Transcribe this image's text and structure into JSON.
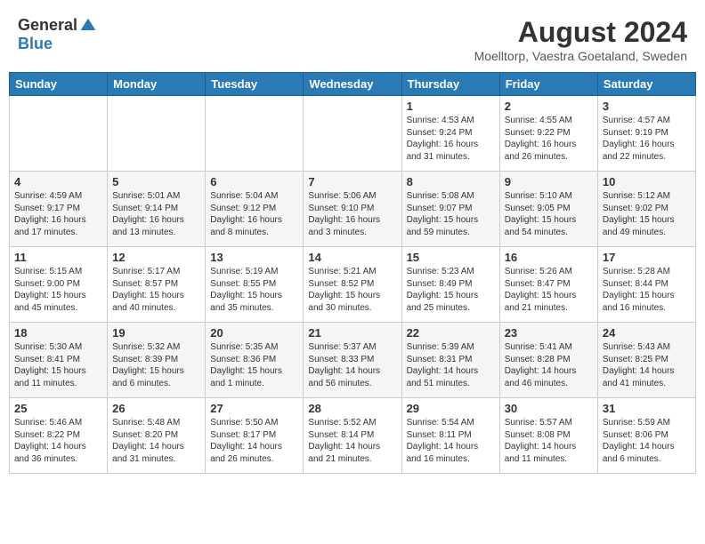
{
  "header": {
    "logo_general": "General",
    "logo_blue": "Blue",
    "month_title": "August 2024",
    "location": "Moelltorp, Vaestra Goetaland, Sweden"
  },
  "weekdays": [
    "Sunday",
    "Monday",
    "Tuesday",
    "Wednesday",
    "Thursday",
    "Friday",
    "Saturday"
  ],
  "weeks": [
    [
      {
        "day": "",
        "info": ""
      },
      {
        "day": "",
        "info": ""
      },
      {
        "day": "",
        "info": ""
      },
      {
        "day": "",
        "info": ""
      },
      {
        "day": "1",
        "info": "Sunrise: 4:53 AM\nSunset: 9:24 PM\nDaylight: 16 hours\nand 31 minutes."
      },
      {
        "day": "2",
        "info": "Sunrise: 4:55 AM\nSunset: 9:22 PM\nDaylight: 16 hours\nand 26 minutes."
      },
      {
        "day": "3",
        "info": "Sunrise: 4:57 AM\nSunset: 9:19 PM\nDaylight: 16 hours\nand 22 minutes."
      }
    ],
    [
      {
        "day": "4",
        "info": "Sunrise: 4:59 AM\nSunset: 9:17 PM\nDaylight: 16 hours\nand 17 minutes."
      },
      {
        "day": "5",
        "info": "Sunrise: 5:01 AM\nSunset: 9:14 PM\nDaylight: 16 hours\nand 13 minutes."
      },
      {
        "day": "6",
        "info": "Sunrise: 5:04 AM\nSunset: 9:12 PM\nDaylight: 16 hours\nand 8 minutes."
      },
      {
        "day": "7",
        "info": "Sunrise: 5:06 AM\nSunset: 9:10 PM\nDaylight: 16 hours\nand 3 minutes."
      },
      {
        "day": "8",
        "info": "Sunrise: 5:08 AM\nSunset: 9:07 PM\nDaylight: 15 hours\nand 59 minutes."
      },
      {
        "day": "9",
        "info": "Sunrise: 5:10 AM\nSunset: 9:05 PM\nDaylight: 15 hours\nand 54 minutes."
      },
      {
        "day": "10",
        "info": "Sunrise: 5:12 AM\nSunset: 9:02 PM\nDaylight: 15 hours\nand 49 minutes."
      }
    ],
    [
      {
        "day": "11",
        "info": "Sunrise: 5:15 AM\nSunset: 9:00 PM\nDaylight: 15 hours\nand 45 minutes."
      },
      {
        "day": "12",
        "info": "Sunrise: 5:17 AM\nSunset: 8:57 PM\nDaylight: 15 hours\nand 40 minutes."
      },
      {
        "day": "13",
        "info": "Sunrise: 5:19 AM\nSunset: 8:55 PM\nDaylight: 15 hours\nand 35 minutes."
      },
      {
        "day": "14",
        "info": "Sunrise: 5:21 AM\nSunset: 8:52 PM\nDaylight: 15 hours\nand 30 minutes."
      },
      {
        "day": "15",
        "info": "Sunrise: 5:23 AM\nSunset: 8:49 PM\nDaylight: 15 hours\nand 25 minutes."
      },
      {
        "day": "16",
        "info": "Sunrise: 5:26 AM\nSunset: 8:47 PM\nDaylight: 15 hours\nand 21 minutes."
      },
      {
        "day": "17",
        "info": "Sunrise: 5:28 AM\nSunset: 8:44 PM\nDaylight: 15 hours\nand 16 minutes."
      }
    ],
    [
      {
        "day": "18",
        "info": "Sunrise: 5:30 AM\nSunset: 8:41 PM\nDaylight: 15 hours\nand 11 minutes."
      },
      {
        "day": "19",
        "info": "Sunrise: 5:32 AM\nSunset: 8:39 PM\nDaylight: 15 hours\nand 6 minutes."
      },
      {
        "day": "20",
        "info": "Sunrise: 5:35 AM\nSunset: 8:36 PM\nDaylight: 15 hours\nand 1 minute."
      },
      {
        "day": "21",
        "info": "Sunrise: 5:37 AM\nSunset: 8:33 PM\nDaylight: 14 hours\nand 56 minutes."
      },
      {
        "day": "22",
        "info": "Sunrise: 5:39 AM\nSunset: 8:31 PM\nDaylight: 14 hours\nand 51 minutes."
      },
      {
        "day": "23",
        "info": "Sunrise: 5:41 AM\nSunset: 8:28 PM\nDaylight: 14 hours\nand 46 minutes."
      },
      {
        "day": "24",
        "info": "Sunrise: 5:43 AM\nSunset: 8:25 PM\nDaylight: 14 hours\nand 41 minutes."
      }
    ],
    [
      {
        "day": "25",
        "info": "Sunrise: 5:46 AM\nSunset: 8:22 PM\nDaylight: 14 hours\nand 36 minutes."
      },
      {
        "day": "26",
        "info": "Sunrise: 5:48 AM\nSunset: 8:20 PM\nDaylight: 14 hours\nand 31 minutes."
      },
      {
        "day": "27",
        "info": "Sunrise: 5:50 AM\nSunset: 8:17 PM\nDaylight: 14 hours\nand 26 minutes."
      },
      {
        "day": "28",
        "info": "Sunrise: 5:52 AM\nSunset: 8:14 PM\nDaylight: 14 hours\nand 21 minutes."
      },
      {
        "day": "29",
        "info": "Sunrise: 5:54 AM\nSunset: 8:11 PM\nDaylight: 14 hours\nand 16 minutes."
      },
      {
        "day": "30",
        "info": "Sunrise: 5:57 AM\nSunset: 8:08 PM\nDaylight: 14 hours\nand 11 minutes."
      },
      {
        "day": "31",
        "info": "Sunrise: 5:59 AM\nSunset: 8:06 PM\nDaylight: 14 hours\nand 6 minutes."
      }
    ]
  ]
}
